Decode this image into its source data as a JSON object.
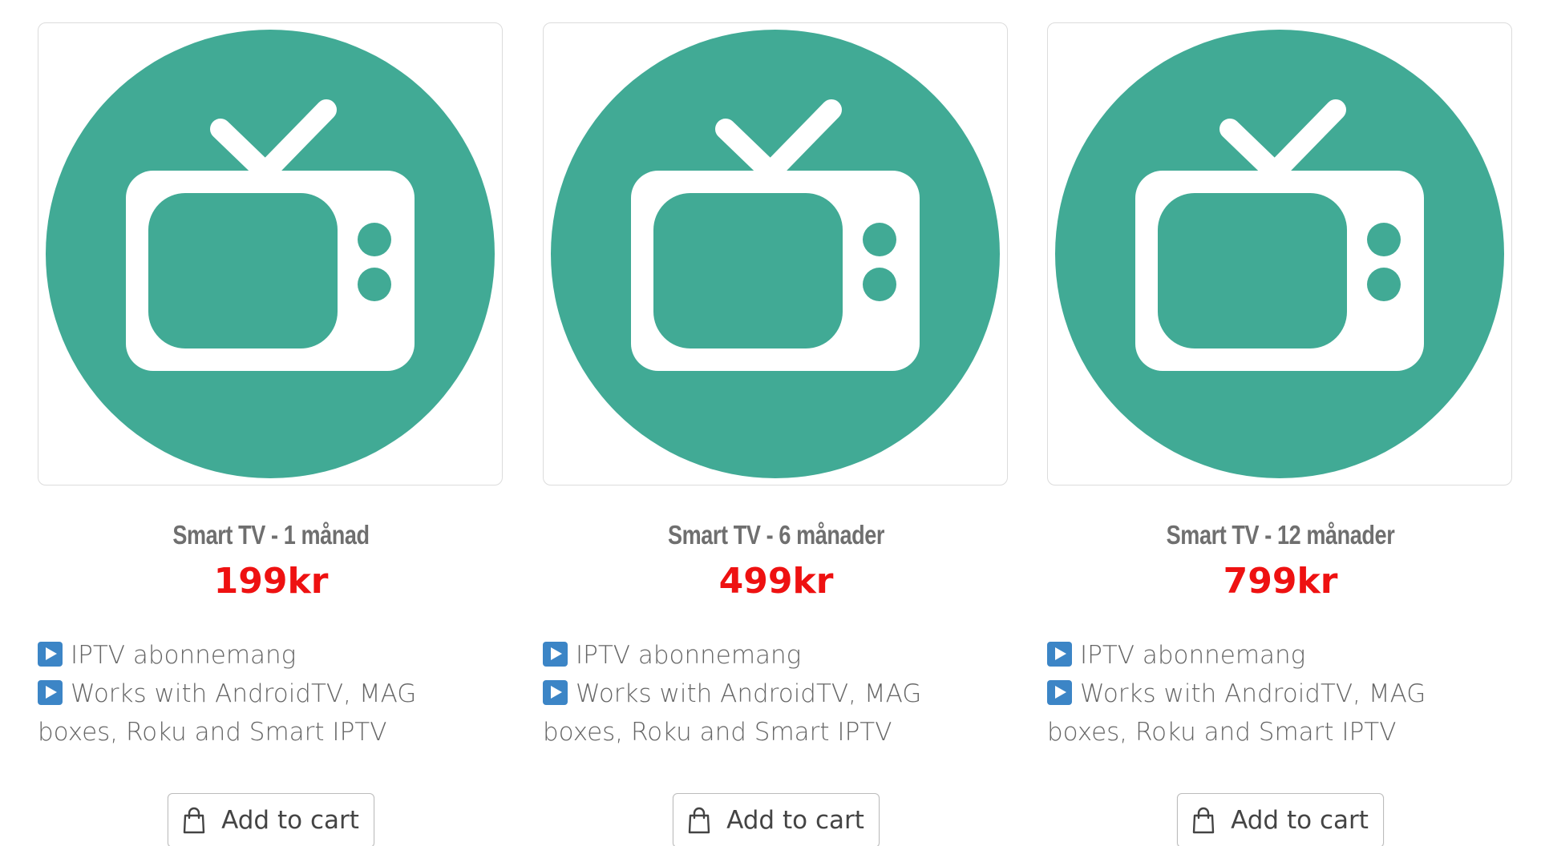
{
  "theme": {
    "tv_circle_color": "#41aa95",
    "price_color": "#ee1111",
    "feature_icon_color": "#3c85c6"
  },
  "products": [
    {
      "image_icon": "tv-icon",
      "title": "Smart TV - 1 månad",
      "price": "199kr",
      "features": [
        "IPTV abonnemang",
        "Works with AndroidTV, MAG boxes, Roku and Smart IPTV"
      ],
      "feature_icon": "play-button-icon",
      "add_to_cart_label": "Add to cart",
      "cart_icon": "shopping-bag-icon"
    },
    {
      "image_icon": "tv-icon",
      "title": "Smart TV - 6 månader",
      "price": "499kr",
      "features": [
        "IPTV abonnemang",
        "Works with AndroidTV, MAG boxes, Roku and Smart IPTV"
      ],
      "feature_icon": "play-button-icon",
      "add_to_cart_label": "Add to cart",
      "cart_icon": "shopping-bag-icon"
    },
    {
      "image_icon": "tv-icon",
      "title": "Smart TV - 12 månader",
      "price": "799kr",
      "features": [
        "IPTV abonnemang",
        "Works with AndroidTV, MAG boxes, Roku and Smart IPTV"
      ],
      "feature_icon": "play-button-icon",
      "add_to_cart_label": "Add to cart",
      "cart_icon": "shopping-bag-icon"
    }
  ]
}
